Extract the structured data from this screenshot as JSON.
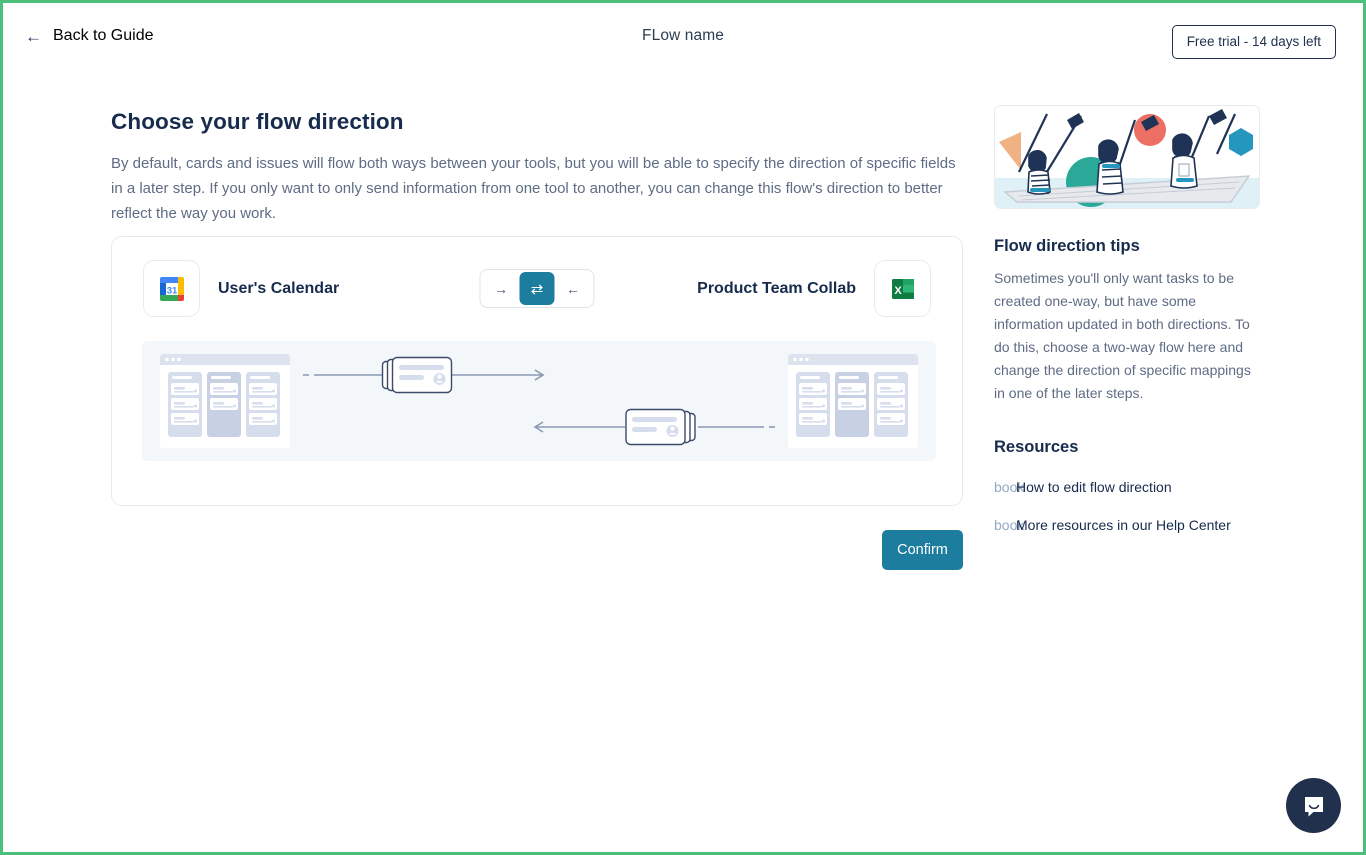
{
  "topbar": {
    "back_label": "Back to Guide",
    "back_icon": "arrow-left-icon",
    "flow_title": "FLow name",
    "trial_badge": "Free trial - 14 days left"
  },
  "main": {
    "heading": "Choose your flow direction",
    "description": "By default, cards and issues will flow both ways between your tools, but you will be able to specify the direction of specific fields in a later step. If you only want to only send information from one tool to another, you can change this flow's direction to better reflect the way you work.",
    "confirm_label": "Confirm"
  },
  "flow": {
    "left_tool": {
      "name": "User's Calendar",
      "icon": "google-calendar-icon",
      "icon_day": "31"
    },
    "right_tool": {
      "name": "Product Team Collab",
      "icon": "microsoft-excel-icon",
      "icon_letter": "X"
    },
    "direction_options": [
      {
        "id": "one-way-right",
        "glyph": "→",
        "selected": false
      },
      {
        "id": "two-way",
        "glyph": "⇄",
        "selected": true
      },
      {
        "id": "one-way-left",
        "glyph": "←",
        "selected": false
      }
    ]
  },
  "sidebar": {
    "illustration": "rowing-boat-teamwork-illustration",
    "tips_heading": "Flow direction tips",
    "tips_body": "Sometimes you'll only want tasks to be created one-way, but have some information updated in both directions. To do this, choose a two-way flow here and change the direction of specific mappings in one of the later steps.",
    "resources_heading": "Resources",
    "resources": [
      {
        "icon_fallback_text": "book",
        "label": "How to edit flow direction"
      },
      {
        "icon_fallback_text": "book",
        "label": "More resources in our Help Center"
      }
    ]
  },
  "chat": {
    "icon": "chat-bubble-icon"
  },
  "colors": {
    "accent": "#1d7d9e",
    "frame_green": "#4cbf7c",
    "navy": "#21304d",
    "text_muted": "#5e6c84"
  }
}
